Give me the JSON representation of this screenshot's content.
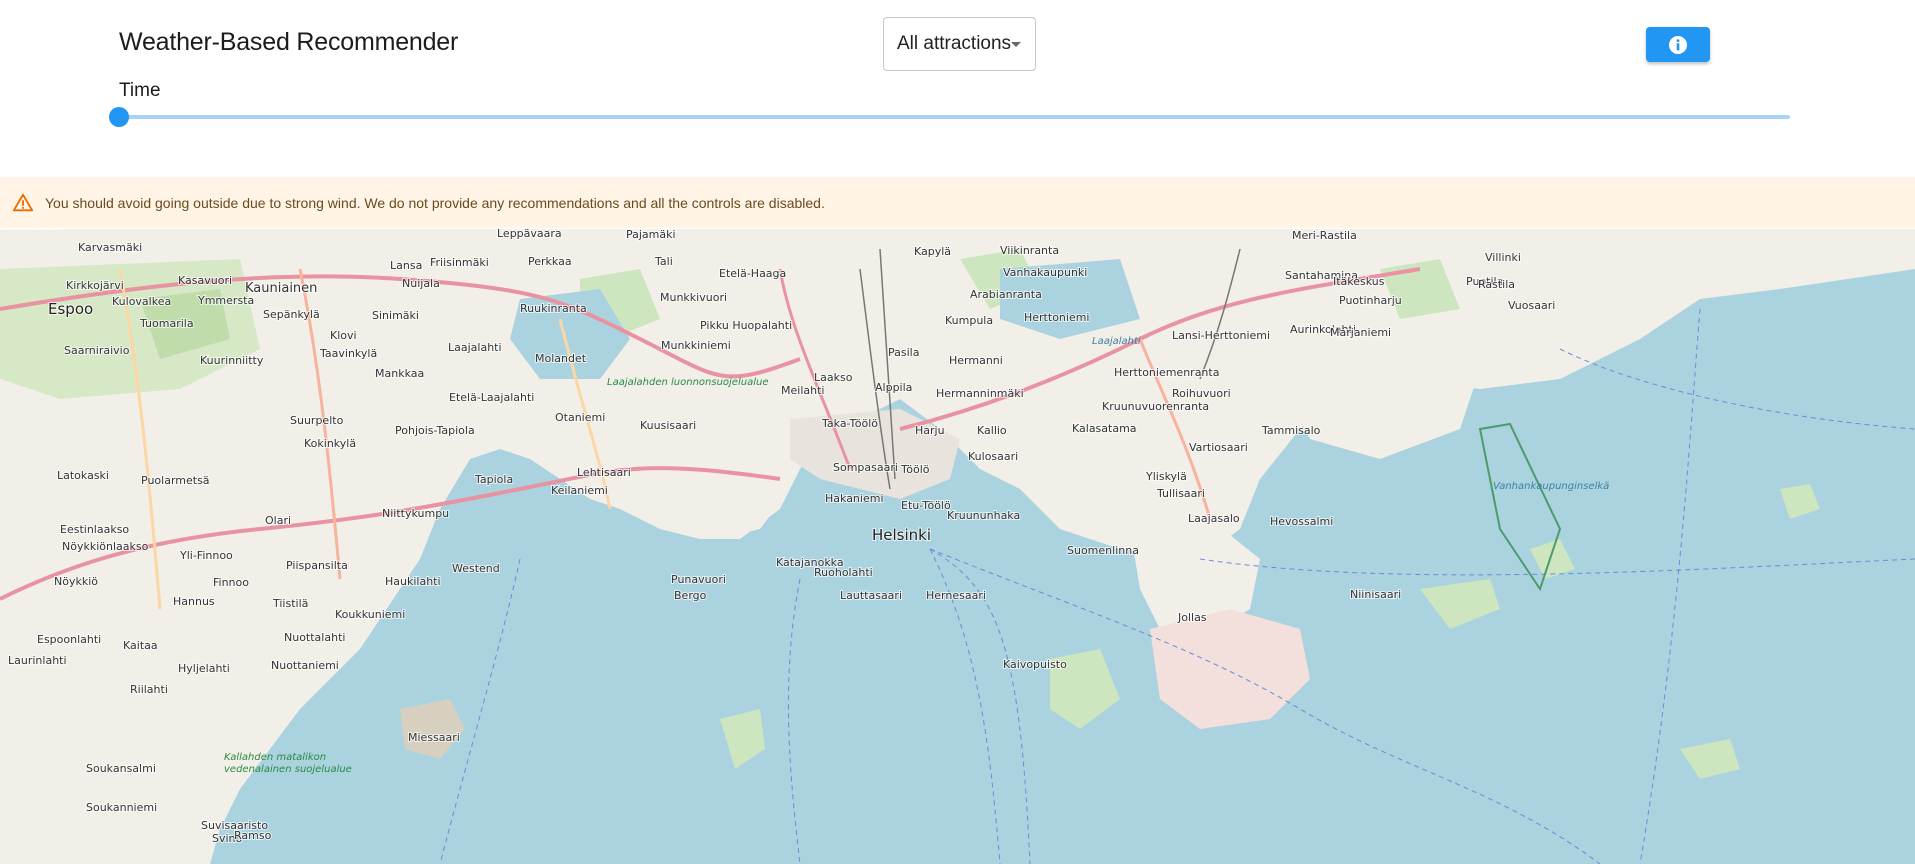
{
  "header": {
    "title": "Weather-Based Recommender",
    "filter": {
      "selected": "All attractions",
      "icon": "chevron-down-icon"
    },
    "info_button": {
      "icon": "info-icon",
      "color": "#2196f3"
    },
    "time": {
      "label": "Time",
      "value_fraction": 0.0
    }
  },
  "alert": {
    "icon": "warning-icon",
    "color": "#ed6c02",
    "background": "#fff4e5",
    "message": "You should avoid going outside due to strong wind. We do not provide any recommendations and all the controls are disabled."
  },
  "map": {
    "water_color": "#aad3df",
    "land_color": "#f2efe9",
    "places": [
      {
        "name": "Helsinki",
        "type": "city"
      },
      {
        "name": "Espoo",
        "type": "city"
      },
      {
        "name": "Kauniainen",
        "type": "big"
      },
      {
        "name": "Karvasmäki",
        "type": "small"
      },
      {
        "name": "Kirkkojärvi",
        "type": "small"
      },
      {
        "name": "Kulovalkea",
        "type": "small"
      },
      {
        "name": "Kasavuori",
        "type": "small"
      },
      {
        "name": "Ymmersta",
        "type": "small"
      },
      {
        "name": "Tuomarila",
        "type": "small"
      },
      {
        "name": "Sepänkylä",
        "type": "small"
      },
      {
        "name": "Saarniraivio",
        "type": "small"
      },
      {
        "name": "Kuurinniitty",
        "type": "small"
      },
      {
        "name": "Klovi",
        "type": "small"
      },
      {
        "name": "Taavinkylä",
        "type": "small"
      },
      {
        "name": "Lansa",
        "type": "small"
      },
      {
        "name": "Friisinmäki",
        "type": "small"
      },
      {
        "name": "Perkkaa",
        "type": "small"
      },
      {
        "name": "Nuijala",
        "type": "small"
      },
      {
        "name": "Sinimäki",
        "type": "small"
      },
      {
        "name": "Leppävaara",
        "type": "small"
      },
      {
        "name": "Ruukinranta",
        "type": "small"
      },
      {
        "name": "Laajalahti",
        "type": "small"
      },
      {
        "name": "Mankkaa",
        "type": "small"
      },
      {
        "name": "Etelä-Laajalahti",
        "type": "small"
      },
      {
        "name": "Suurpelto",
        "type": "small"
      },
      {
        "name": "Pohjois-Tapiola",
        "type": "small"
      },
      {
        "name": "Otaniemi",
        "type": "small"
      },
      {
        "name": "Kokinkylä",
        "type": "small"
      },
      {
        "name": "Latokaski",
        "type": "small"
      },
      {
        "name": "Puolarmetsä",
        "type": "small"
      },
      {
        "name": "Tapiola",
        "type": "small"
      },
      {
        "name": "Lehtisaari",
        "type": "small"
      },
      {
        "name": "Kuusisaari",
        "type": "small"
      },
      {
        "name": "Keilaniemi",
        "type": "small"
      },
      {
        "name": "Niittykumpu",
        "type": "small"
      },
      {
        "name": "Olari",
        "type": "small"
      },
      {
        "name": "Eestinlaakso",
        "type": "small"
      },
      {
        "name": "Nöykkiönlaakso",
        "type": "small"
      },
      {
        "name": "Yli-Finnoo",
        "type": "small"
      },
      {
        "name": "Piispansilta",
        "type": "small"
      },
      {
        "name": "Westend",
        "type": "small"
      },
      {
        "name": "Nöykkiö",
        "type": "small"
      },
      {
        "name": "Finnoo",
        "type": "small"
      },
      {
        "name": "Haukilahti",
        "type": "small"
      },
      {
        "name": "Hannus",
        "type": "small"
      },
      {
        "name": "Tiistilä",
        "type": "small"
      },
      {
        "name": "Koukkuniemi",
        "type": "small"
      },
      {
        "name": "Espoonlahti",
        "type": "small"
      },
      {
        "name": "Nuottalahti",
        "type": "small"
      },
      {
        "name": "Kaitaa",
        "type": "small"
      },
      {
        "name": "Laurinlahti",
        "type": "small"
      },
      {
        "name": "Hyljelahti",
        "type": "small"
      },
      {
        "name": "Nuottaniemi",
        "type": "small"
      },
      {
        "name": "Riilahti",
        "type": "small"
      },
      {
        "name": "Miessaari",
        "type": "small"
      },
      {
        "name": "Soukansalmi",
        "type": "small"
      },
      {
        "name": "Soukanniemi",
        "type": "small"
      },
      {
        "name": "Suvisaaristo",
        "type": "small"
      },
      {
        "name": "Pajamäki",
        "type": "small"
      },
      {
        "name": "Tali",
        "type": "small"
      },
      {
        "name": "Munkkivuori",
        "type": "small"
      },
      {
        "name": "Etelä-Haaga",
        "type": "small"
      },
      {
        "name": "Pikku Huopalahti",
        "type": "small"
      },
      {
        "name": "Munkkiniemi",
        "type": "small"
      },
      {
        "name": "Kapylä",
        "type": "small"
      },
      {
        "name": "Viikinranta",
        "type": "small"
      },
      {
        "name": "Vanhakaupunki",
        "type": "small"
      },
      {
        "name": "Arabianranta",
        "type": "small"
      },
      {
        "name": "Kumpula",
        "type": "small"
      },
      {
        "name": "Pasila",
        "type": "small"
      },
      {
        "name": "Hermanni",
        "type": "small"
      },
      {
        "name": "Laakso",
        "type": "small"
      },
      {
        "name": "Meilahti",
        "type": "small"
      },
      {
        "name": "Alppila",
        "type": "small"
      },
      {
        "name": "Hermanninmäki",
        "type": "small"
      },
      {
        "name": "Taka-Töölö",
        "type": "small"
      },
      {
        "name": "Harju",
        "type": "small"
      },
      {
        "name": "Kallio",
        "type": "small"
      },
      {
        "name": "Kalasatama",
        "type": "small"
      },
      {
        "name": "Kulosaari",
        "type": "small"
      },
      {
        "name": "Sompasaari",
        "type": "small"
      },
      {
        "name": "Töölö",
        "type": "small"
      },
      {
        "name": "Hakaniemi",
        "type": "small"
      },
      {
        "name": "Etu-Töölö",
        "type": "small"
      },
      {
        "name": "Kruununhaka",
        "type": "small"
      },
      {
        "name": "Katajanokka",
        "type": "small"
      },
      {
        "name": "Ruoholahti",
        "type": "small"
      },
      {
        "name": "Punavuori",
        "type": "small"
      },
      {
        "name": "Lauttasaari",
        "type": "small"
      },
      {
        "name": "Hernesaari",
        "type": "small"
      },
      {
        "name": "Kaivopuisto",
        "type": "small"
      },
      {
        "name": "Suomenlinna",
        "type": "small"
      },
      {
        "name": "Kruunuvuorenranta",
        "type": "small"
      },
      {
        "name": "Herttoniemenranta",
        "type": "small"
      },
      {
        "name": "Herttoniemi",
        "type": "small"
      },
      {
        "name": "Lansi-Herttoniemi",
        "type": "small"
      },
      {
        "name": "Roihuvuori",
        "type": "small"
      },
      {
        "name": "Tammisalo",
        "type": "small"
      },
      {
        "name": "Vartiosaari",
        "type": "small"
      },
      {
        "name": "Yliskylä",
        "type": "small"
      },
      {
        "name": "Tullisaari",
        "type": "small"
      },
      {
        "name": "Laajasalo",
        "type": "small"
      },
      {
        "name": "Hevossalmi",
        "type": "small"
      },
      {
        "name": "Jollas",
        "type": "small"
      },
      {
        "name": "Santahamina",
        "type": "small"
      },
      {
        "name": "Itäkeskus",
        "type": "small"
      },
      {
        "name": "Puotinharju",
        "type": "small"
      },
      {
        "name": "Puotila",
        "type": "small"
      },
      {
        "name": "Rastila",
        "type": "small"
      },
      {
        "name": "Vuosaari",
        "type": "small"
      },
      {
        "name": "Aurinkolahti",
        "type": "small"
      },
      {
        "name": "Marjaniemi",
        "type": "small"
      },
      {
        "name": "Meri-Rastila",
        "type": "small"
      },
      {
        "name": "Niinisaari",
        "type": "small"
      },
      {
        "name": "Villinki",
        "type": "small"
      },
      {
        "name": "Molandet",
        "type": "small"
      },
      {
        "name": "Laajalahden luonnonsuojelualue",
        "type": "park"
      },
      {
        "name": "Laajalahti",
        "type": "water"
      },
      {
        "name": "Vanhankaupunginselkä",
        "type": "water"
      },
      {
        "name": "Kallahden matalikon vedenalainen suojelualue",
        "type": "park"
      },
      {
        "name": "Svino",
        "type": "small"
      },
      {
        "name": "Ramso",
        "type": "small"
      },
      {
        "name": "Bergo",
        "type": "small"
      },
      {
        "name": "Lauttasaari",
        "type": "small"
      }
    ]
  }
}
